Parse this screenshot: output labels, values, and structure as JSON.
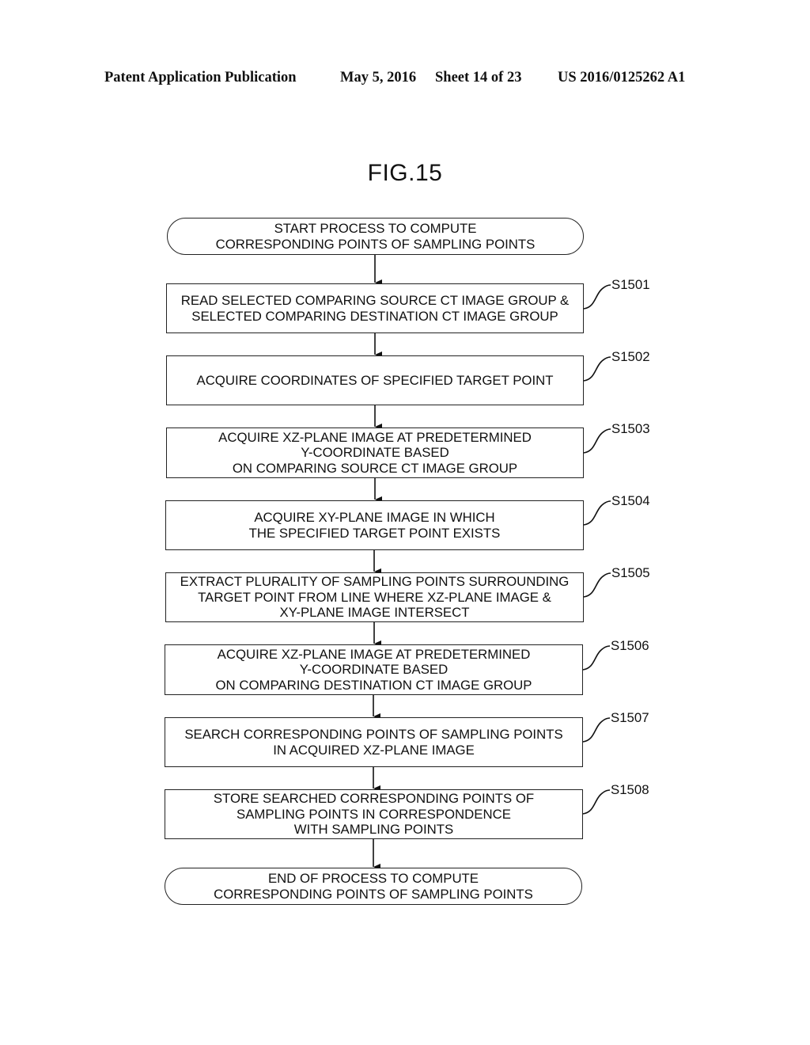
{
  "header": {
    "publication": "Patent Application Publication",
    "date": "May 5, 2016",
    "sheet": "Sheet 14 of 23",
    "number": "US 2016/0125262 A1"
  },
  "figure": {
    "title": "FIG.15"
  },
  "flowchart": {
    "start": "START PROCESS TO COMPUTE\nCORRESPONDING POINTS OF SAMPLING POINTS",
    "steps": [
      {
        "id": "S1501",
        "text": "READ SELECTED COMPARING SOURCE CT IMAGE GROUP &\nSELECTED COMPARING DESTINATION CT IMAGE GROUP"
      },
      {
        "id": "S1502",
        "text": "ACQUIRE COORDINATES OF SPECIFIED TARGET POINT"
      },
      {
        "id": "S1503",
        "text": "ACQUIRE XZ-PLANE IMAGE AT PREDETERMINED\nY-COORDINATE BASED\nON COMPARING SOURCE CT IMAGE GROUP"
      },
      {
        "id": "S1504",
        "text": "ACQUIRE XY-PLANE IMAGE IN WHICH\nTHE SPECIFIED TARGET POINT EXISTS"
      },
      {
        "id": "S1505",
        "text": "EXTRACT PLURALITY OF SAMPLING POINTS SURROUNDING\nTARGET POINT FROM LINE WHERE XZ-PLANE IMAGE &\nXY-PLANE IMAGE INTERSECT"
      },
      {
        "id": "S1506",
        "text": "ACQUIRE XZ-PLANE IMAGE AT PREDETERMINED\nY-COORDINATE BASED\nON COMPARING DESTINATION CT IMAGE GROUP"
      },
      {
        "id": "S1507",
        "text": "SEARCH CORRESPONDING POINTS OF SAMPLING POINTS\nIN ACQUIRED XZ-PLANE IMAGE"
      },
      {
        "id": "S1508",
        "text": "STORE SEARCHED CORRESPONDING POINTS OF\nSAMPLING POINTS IN CORRESPONDENCE\nWITH SAMPLING POINTS"
      }
    ],
    "end": "END OF PROCESS TO COMPUTE\nCORRESPONDING POINTS OF SAMPLING POINTS"
  }
}
